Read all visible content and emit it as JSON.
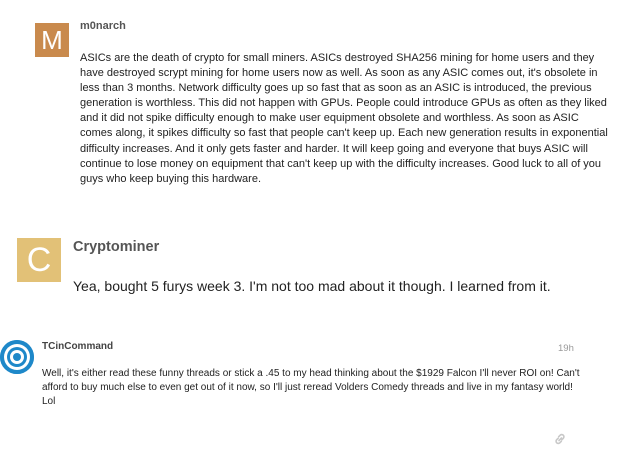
{
  "posts": [
    {
      "author": "m0narch",
      "avatar_letter": "M",
      "avatar_color": "#c98a4d",
      "body": "ASICs are the death of crypto for small miners. ASICs destroyed SHA256 mining for home users and they have destroyed scrypt mining for home users now as well. As soon as any ASIC comes out, it's obsolete in less than 3 months. Network difficulty goes up so fast that as soon as an ASIC is introduced, the previous generation is worthless. This did not happen with GPUs. People could introduce GPUs as often as they liked and it did not spike difficulty enough to make user equipment obsolete and worthless. As soon as ASIC comes along, it spikes difficulty so fast that people can't keep up. Each new generation results in exponential difficulty increases. And it only gets faster and harder. It will keep going and everyone that buys ASIC will continue to lose money on equipment that can't keep up with the difficulty increases. Good luck to all of you guys who keep buying this hardware."
    },
    {
      "author": "Cryptominer",
      "avatar_letter": "C",
      "avatar_color": "#e2c177",
      "body": "Yea, bought 5 furys week 3. I'm not too mad about it though. I learned from it."
    },
    {
      "author": "TCinCommand",
      "avatar_icon": "target-avatar-icon",
      "avatar_color": "#1e88c9",
      "timestamp": "19h",
      "body": "Well, it's either read these funny threads or stick a .45 to my head thinking about the $1929 Falcon I'll never ROI on! Can't afford to buy much else to even get out of it now, so I'll just reread Volders Comedy threads and live in my fantasy world! Lol",
      "footer_icon": "link-icon"
    }
  ]
}
